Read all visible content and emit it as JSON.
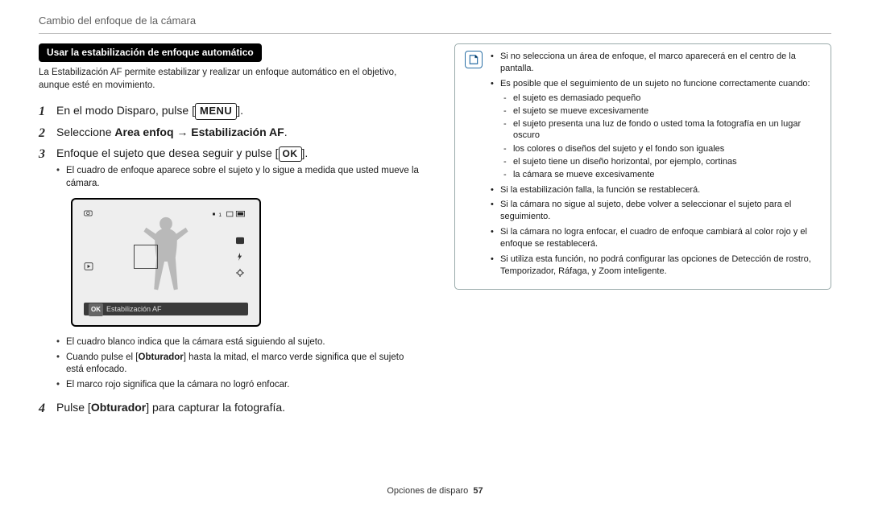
{
  "header": "Cambio del enfoque de la cámara",
  "section_title": "Usar la estabilización de enfoque automático",
  "intro": "La Estabilización AF permite estabilizar y realizar un enfoque automático en el objetivo, aunque esté en movimiento.",
  "step1": {
    "prefix": "En el modo Disparo, pulse [",
    "menu": "MENU",
    "suffix": "]."
  },
  "step2": {
    "prefix": "Seleccione ",
    "bold": "Area enfoq → Estabilización AF",
    "suffix": "."
  },
  "step3": {
    "prefix": "Enfoque el sujeto que desea seguir y pulse [",
    "ok": "OK",
    "suffix": "].",
    "sub1": "El cuadro de enfoque aparece sobre el sujeto y lo sigue a medida que usted mueve la cámara.",
    "screen_caption": "Estabilización AF",
    "screen_caption_btn": "OK",
    "sub2_prefix": "El cuadro blanco indica que la cámara está siguiendo al sujeto.",
    "sub3_a": "Cuando pulse el [",
    "sub3_b": "Obturador",
    "sub3_c": "] hasta la mitad, el marco verde significa que el sujeto está enfocado.",
    "sub4": "El marco rojo significa que la cámara no logró enfocar."
  },
  "step4": {
    "a": "Pulse [",
    "b": "Obturador",
    "c": "] para capturar la fotografía."
  },
  "note": {
    "n1": "Si no selecciona un área de enfoque, el marco aparecerá en el centro de la pantalla.",
    "n2": "Es posible que el seguimiento de un sujeto no funcione correctamente cuando:",
    "n2_d1": "el sujeto es demasiado pequeño",
    "n2_d2": "el sujeto se mueve excesivamente",
    "n2_d3": "el sujeto presenta una luz de fondo o usted toma la fotografía en un lugar oscuro",
    "n2_d4": "los colores o diseños del sujeto y el fondo son iguales",
    "n2_d5": "el sujeto tiene un diseño horizontal, por ejemplo, cortinas",
    "n2_d6": "la cámara se mueve excesivamente",
    "n3": "Si la estabilización falla, la función se restablecerá.",
    "n4": "Si la cámara no sigue al sujeto, debe volver a seleccionar el sujeto para el seguimiento.",
    "n5": "Si la cámara no logra enfocar, el cuadro de enfoque cambiará al color rojo y el enfoque se restablecerá.",
    "n6": "Si utiliza esta función, no podrá configurar las opciones de Detección de rostro, Temporizador, Ráfaga, y Zoom inteligente."
  },
  "footer": {
    "section": "Opciones de disparo",
    "page": "57"
  }
}
